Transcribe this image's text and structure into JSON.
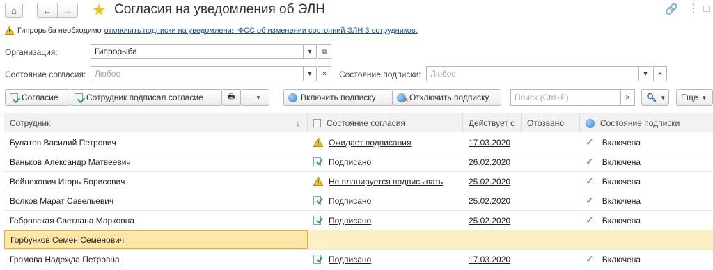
{
  "header": {
    "title": "Согласия на уведомления об ЭЛН"
  },
  "warning": {
    "text": "Гипрорыба необходимо",
    "link": "отключить подписки на уведомления ФСС об изменении состояний ЭЛН 3 сотрудников."
  },
  "filters": {
    "org_label": "Организация:",
    "org_value": "Гипрорыба",
    "consent_label": "Состояние согласия:",
    "consent_placeholder": "Любое",
    "sub_label": "Состояние подписки:",
    "sub_placeholder": "Любое"
  },
  "toolbar": {
    "consent": "Согласие",
    "signed": "Сотрудник подписал согласие",
    "more": "...",
    "enable": "Включить подписку",
    "disable": "Отключить подписку",
    "search_placeholder": "Поиск (Ctrl+F)",
    "more2": "Еще"
  },
  "table": {
    "headers": {
      "employee": "Сотрудник",
      "consent_state": "Состояние согласия",
      "valid_from": "Действует с",
      "revoked": "Отозвано",
      "sub_state": "Состояние подписки"
    },
    "rows": [
      {
        "name": "Булатов Василий Петрович",
        "status": "Ожидает подписания",
        "status_type": "warn",
        "date": "17.03.2020",
        "sub": "Включена"
      },
      {
        "name": "Ваньков Александр Матвеевич",
        "status": "Подписано",
        "status_type": "ok",
        "date": "26.02.2020",
        "sub": "Включена"
      },
      {
        "name": "Войцехович Игорь Борисович",
        "status": "Не планируется подписывать",
        "status_type": "warn",
        "date": "25.02.2020",
        "sub": "Включена"
      },
      {
        "name": "Волков Марат Савельевич",
        "status": "Подписано",
        "status_type": "ok",
        "date": "25.02.2020",
        "sub": "Включена"
      },
      {
        "name": "Габровская Светлана Марковна",
        "status": "Подписано",
        "status_type": "ok",
        "date": "25.02.2020",
        "sub": "Включена"
      },
      {
        "name": "Горбунков Семен Семенович",
        "status": "",
        "status_type": "",
        "date": "",
        "sub": ""
      },
      {
        "name": "Громова Надежда Петровна",
        "status": "Подписано",
        "status_type": "ok",
        "date": "17.03.2020",
        "sub": "Включена"
      }
    ]
  }
}
